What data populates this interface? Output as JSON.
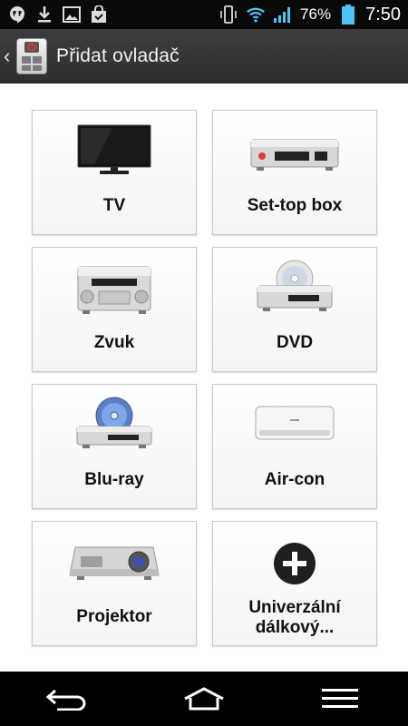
{
  "status_bar": {
    "battery_percent": "76%",
    "time": "7:50",
    "icons_left": [
      "hangouts-icon",
      "download-icon",
      "gallery-icon",
      "shopping-bag-icon"
    ],
    "icons_right": [
      "vibrate-icon",
      "wifi-icon",
      "signal-icon",
      "battery-icon"
    ]
  },
  "app_bar": {
    "title": "Přidat ovladač",
    "back_icon": "chevron-left-icon",
    "app_icon": "remote-app-icon"
  },
  "devices": [
    {
      "label": "TV",
      "icon": "tv-icon"
    },
    {
      "label": "Set-top box",
      "icon": "set-top-box-icon"
    },
    {
      "label": "Zvuk",
      "icon": "audio-system-icon"
    },
    {
      "label": "DVD",
      "icon": "dvd-player-icon"
    },
    {
      "label": "Blu-ray",
      "icon": "blu-ray-player-icon"
    },
    {
      "label": "Air-con",
      "icon": "air-conditioner-icon"
    },
    {
      "label": "Projektor",
      "icon": "projector-icon"
    },
    {
      "label_line1": "Univerzální",
      "label_line2": "dálkový...",
      "icon": "plus-circle-icon"
    }
  ],
  "nav_bar": {
    "icons": [
      "back-icon",
      "home-icon",
      "menu-icon"
    ]
  },
  "colors": {
    "app_bar": "#363636",
    "status_bar": "#0a0a0a",
    "battery": "#4fc3f7",
    "signal": "#4fc3f7",
    "tile_border": "#c9c9c9"
  }
}
